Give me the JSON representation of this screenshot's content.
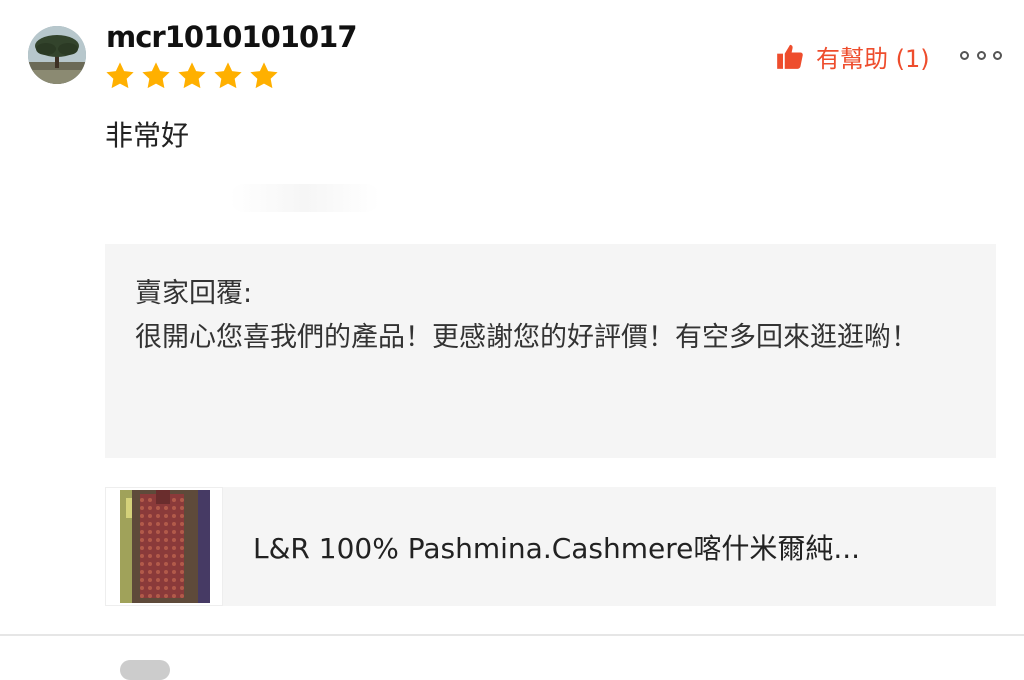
{
  "review": {
    "username": "mcr1010101017",
    "rating": 5,
    "rating_max": 5,
    "helpful_label": "有幫助 (1)",
    "comment": "非常好"
  },
  "seller_reply": {
    "title": "賣家回覆:",
    "text": "很開心您喜我們的產品！更感謝您的好評價！有空多回來逛逛喲！"
  },
  "product": {
    "name": "L&R 100% Pashmina.Cashmere喀什米爾純..."
  },
  "colors": {
    "accent": "#ee4d2d",
    "star": "#ffb000",
    "panel": "#f5f5f5"
  },
  "icons": {
    "helpful": "thumbs-up-icon",
    "more": "more-options-icon",
    "star": "star-icon"
  }
}
